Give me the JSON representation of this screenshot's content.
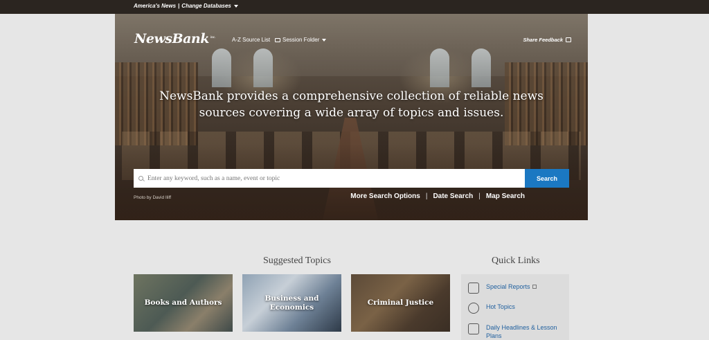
{
  "topbar": {
    "database": "America's News",
    "separator": "|",
    "change": "Change Databases"
  },
  "header": {
    "logo": "NewsBank",
    "logo_suffix": "inc.",
    "az_source": "A-Z Source List",
    "session_folder": "Session Folder",
    "share_feedback": "Share Feedback"
  },
  "hero": {
    "headline": "NewsBank provides a comprehensive collection of reliable news sources covering a wide array of topics and issues.",
    "search_placeholder": "Enter any keyword, such as a name, event or topic",
    "search_button": "Search",
    "photo_credit": "Photo by David Iliff",
    "more_search": "More Search Options",
    "date_search": "Date Search",
    "map_search": "Map Search",
    "pipe": "|"
  },
  "suggested": {
    "title": "Suggested Topics",
    "topics": [
      {
        "label": "Books and Authors"
      },
      {
        "label": "Business and Economics"
      },
      {
        "label": "Criminal Justice"
      }
    ]
  },
  "quick_links": {
    "title": "Quick Links",
    "items": [
      {
        "label": "Special Reports",
        "icon": "report-icon"
      },
      {
        "label": "Hot Topics",
        "icon": "globe-icon"
      },
      {
        "label": "Daily Headlines & Lesson Plans",
        "icon": "newspaper-icon"
      }
    ]
  }
}
